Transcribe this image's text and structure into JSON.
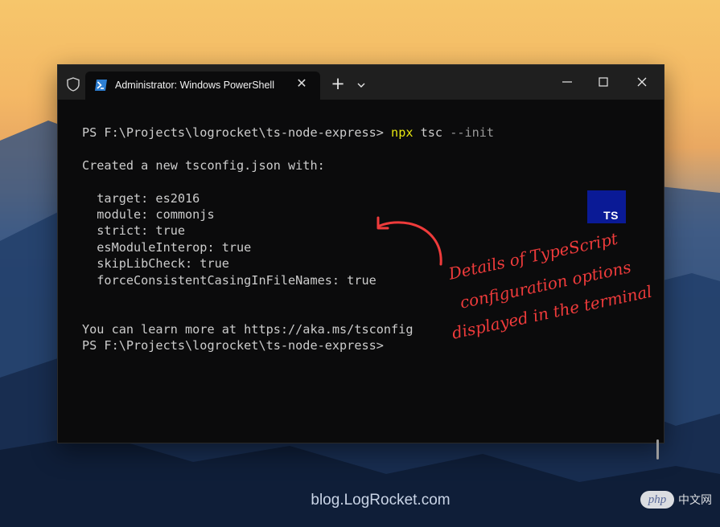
{
  "window": {
    "tab_title": "Administrator: Windows PowerShell",
    "tab_icon": "powershell-icon",
    "close_tab_glyph": "✕",
    "new_tab_glyph": "+",
    "dropdown_glyph": "⌄",
    "minimize_glyph": "—",
    "maximize_glyph": "☐",
    "close_window_glyph": "✕"
  },
  "terminal": {
    "prompt1": "PS F:\\Projects\\logrocket\\ts-node-express> ",
    "command": "npx",
    "command_args": " tsc ",
    "command_flag": "--init",
    "created": "Created a new tsconfig.json with:",
    "options": [
      "  target: es2016",
      "  module: commonjs",
      "  strict: true",
      "  esModuleInterop: true",
      "  skipLibCheck: true",
      "  forceConsistentCasingInFileNames: true"
    ],
    "learn_more": "You can learn more at https://aka.ms/tsconfig",
    "prompt2": "PS F:\\Projects\\logrocket\\ts-node-express>"
  },
  "ts_badge": "TS",
  "annotation": {
    "line1": "Details of TypeScript",
    "line2": "configuration options",
    "line3": "displayed in the terminal",
    "color": "#ef3b3b"
  },
  "footer": {
    "url": "blog.LogRocket.com",
    "watermark_badge": "php",
    "watermark_text": "中文网"
  },
  "colors": {
    "terminal_bg": "#0b0b0c",
    "command_yellow": "#e5e510",
    "text_gray": "#cccccc",
    "ts_blue": "#0a1a96"
  }
}
